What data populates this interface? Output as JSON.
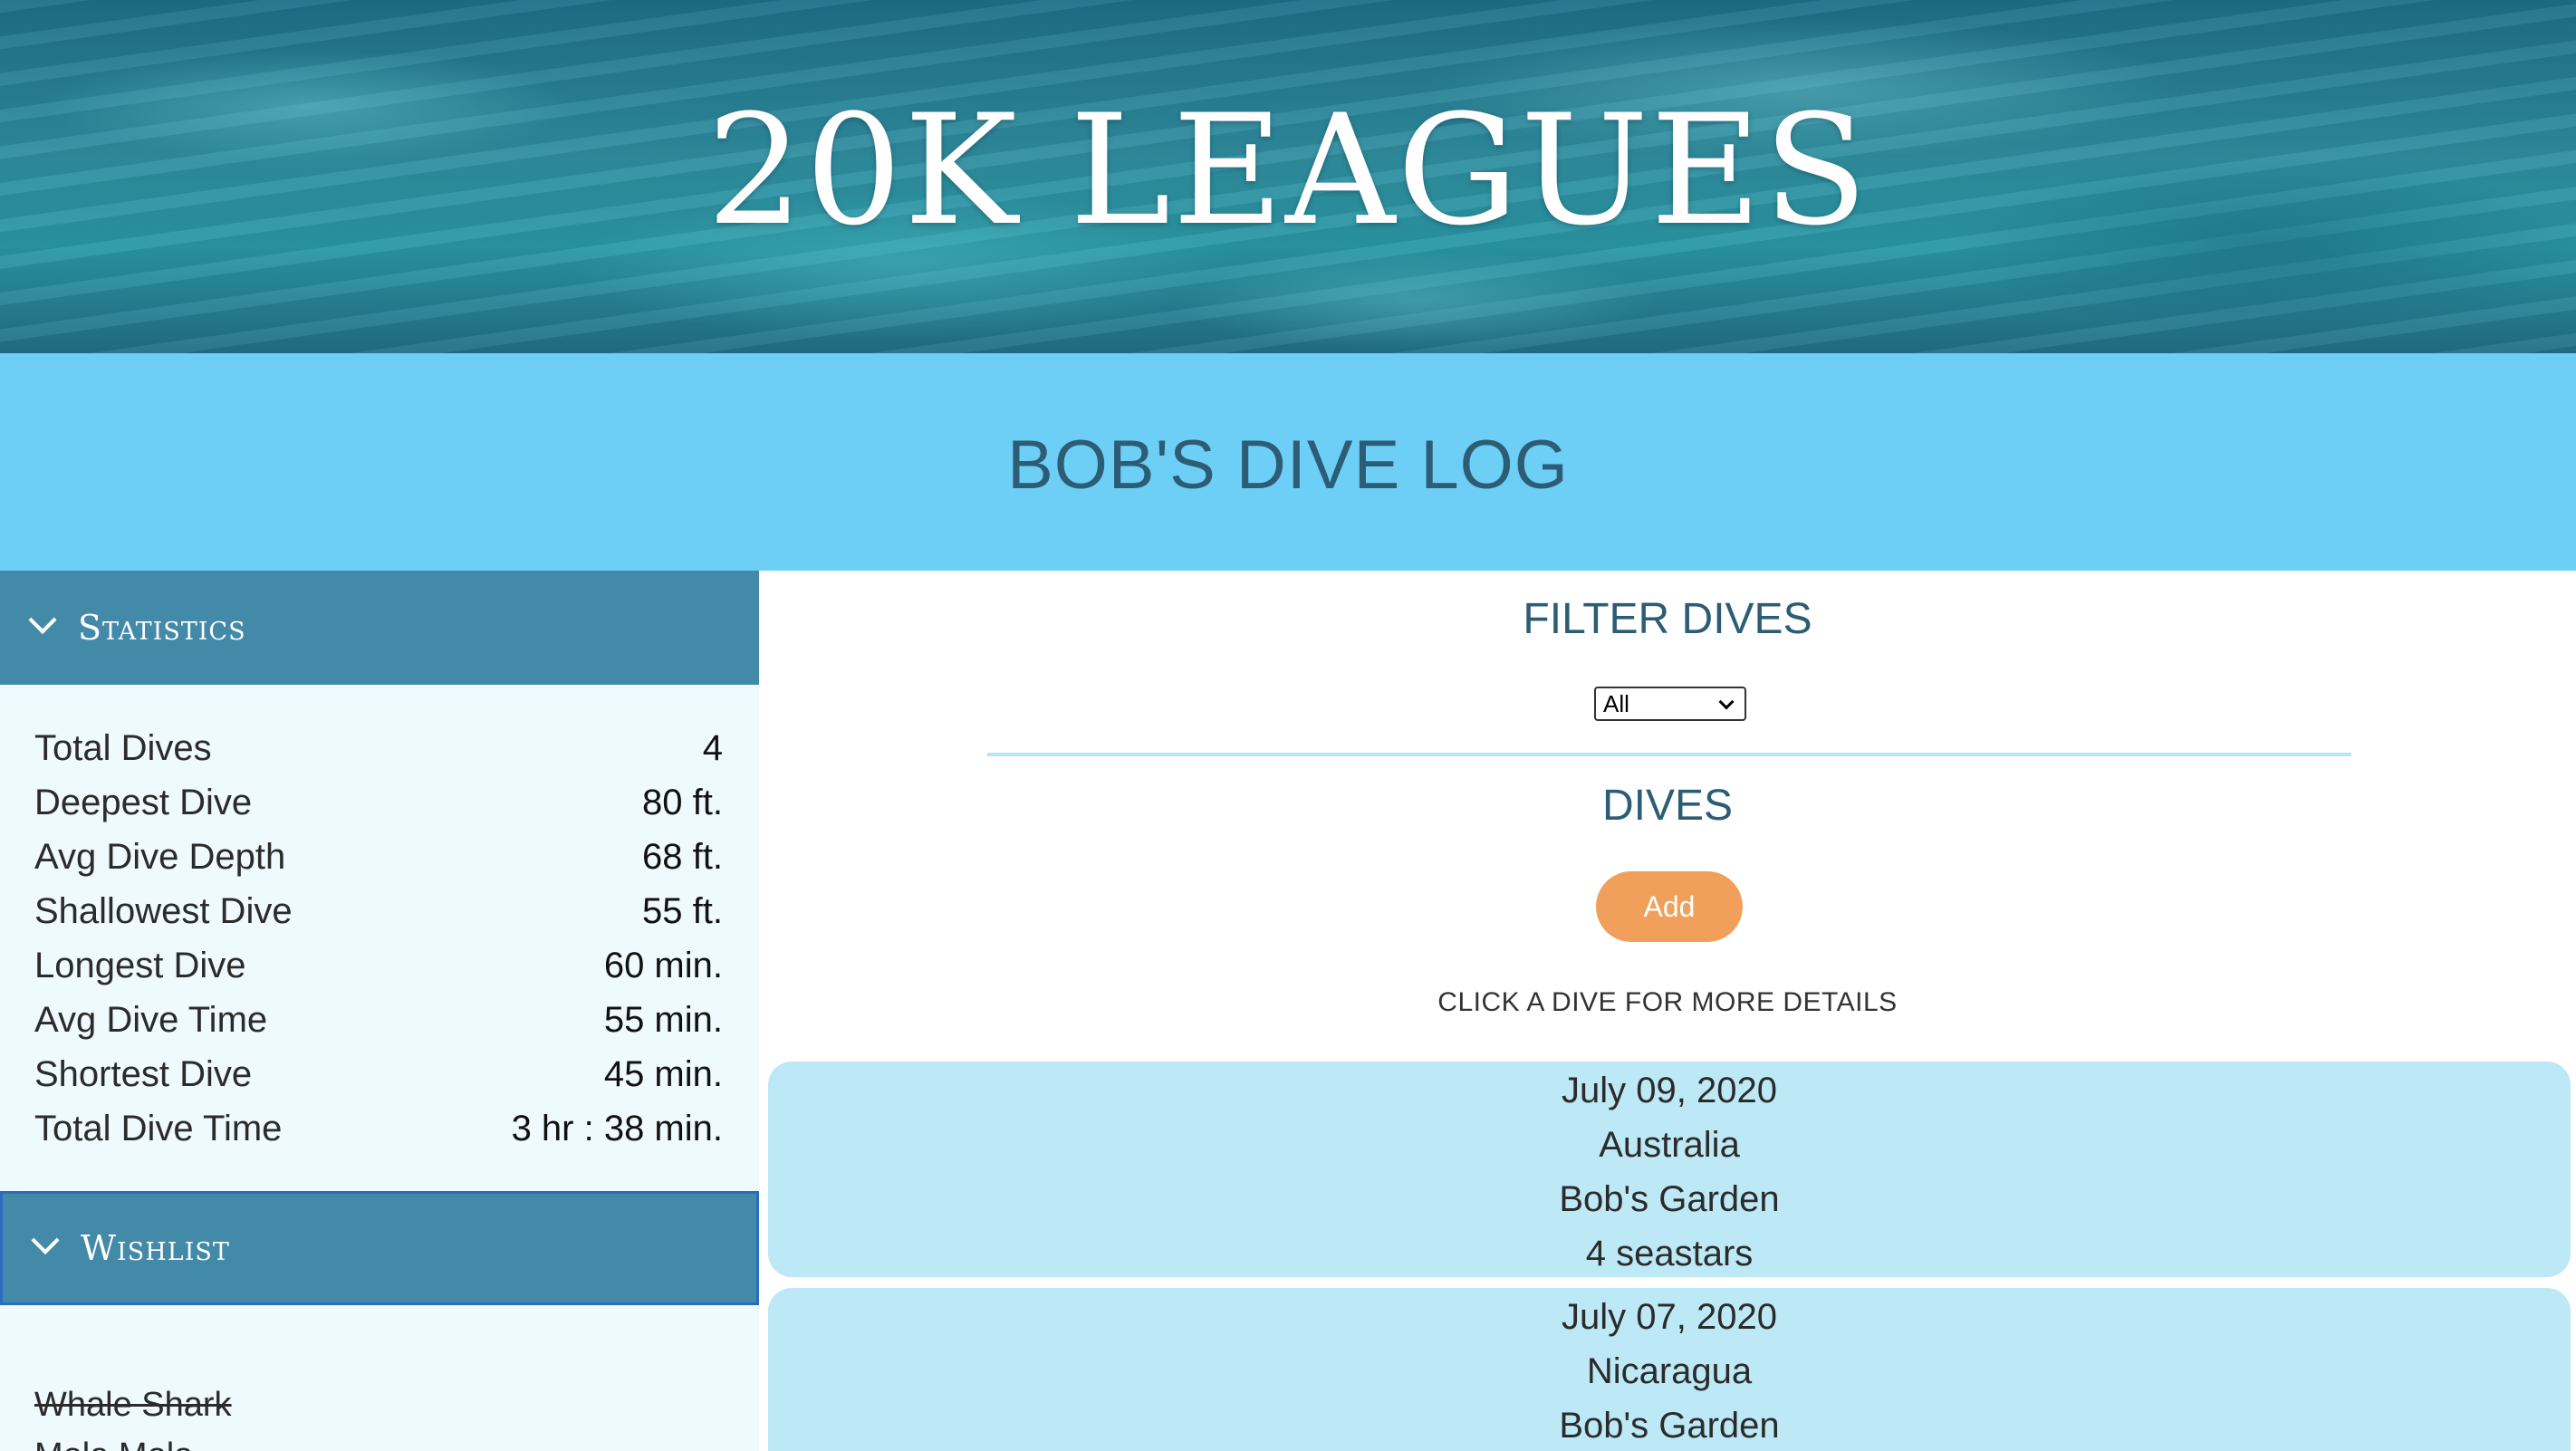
{
  "hero": {
    "title": "20K LEAGUES"
  },
  "page": {
    "title": "BOB'S DIVE LOG"
  },
  "sidebar": {
    "statistics": {
      "label": "Statistics",
      "rows": [
        {
          "label": "Total Dives",
          "value": "4"
        },
        {
          "label": "Deepest Dive",
          "value": "80 ft."
        },
        {
          "label": "Avg Dive Depth",
          "value": "68 ft."
        },
        {
          "label": "Shallowest Dive",
          "value": "55 ft."
        },
        {
          "label": "Longest Dive",
          "value": "60 min."
        },
        {
          "label": "Avg Dive Time",
          "value": "55 min."
        },
        {
          "label": "Shortest Dive",
          "value": "45 min."
        },
        {
          "label": "Total Dive Time",
          "value": "3 hr : 38 min."
        }
      ]
    },
    "wishlist": {
      "label": "Wishlist",
      "items": [
        {
          "label": "Whale Shark",
          "completed": true
        },
        {
          "label": "Mola Mola",
          "completed": false
        }
      ]
    }
  },
  "main": {
    "filter": {
      "title": "FILTER DIVES",
      "selected": "All"
    },
    "dives": {
      "title": "DIVES",
      "add_label": "Add",
      "hint": "CLICK A DIVE FOR MORE DETAILS",
      "items": [
        {
          "date": "July 09, 2020",
          "country": "Australia",
          "site": "Bob's Garden",
          "rating": "4 seastars"
        },
        {
          "date": "July 07, 2020",
          "country": "Nicaragua",
          "site": "Bob's Garden"
        }
      ]
    }
  },
  "colors": {
    "band": "#6dcff6",
    "accordion_header": "#4389a8",
    "card": "#bde8f6",
    "add_button": "#f0a05a",
    "title_text": "#2c5d75"
  }
}
